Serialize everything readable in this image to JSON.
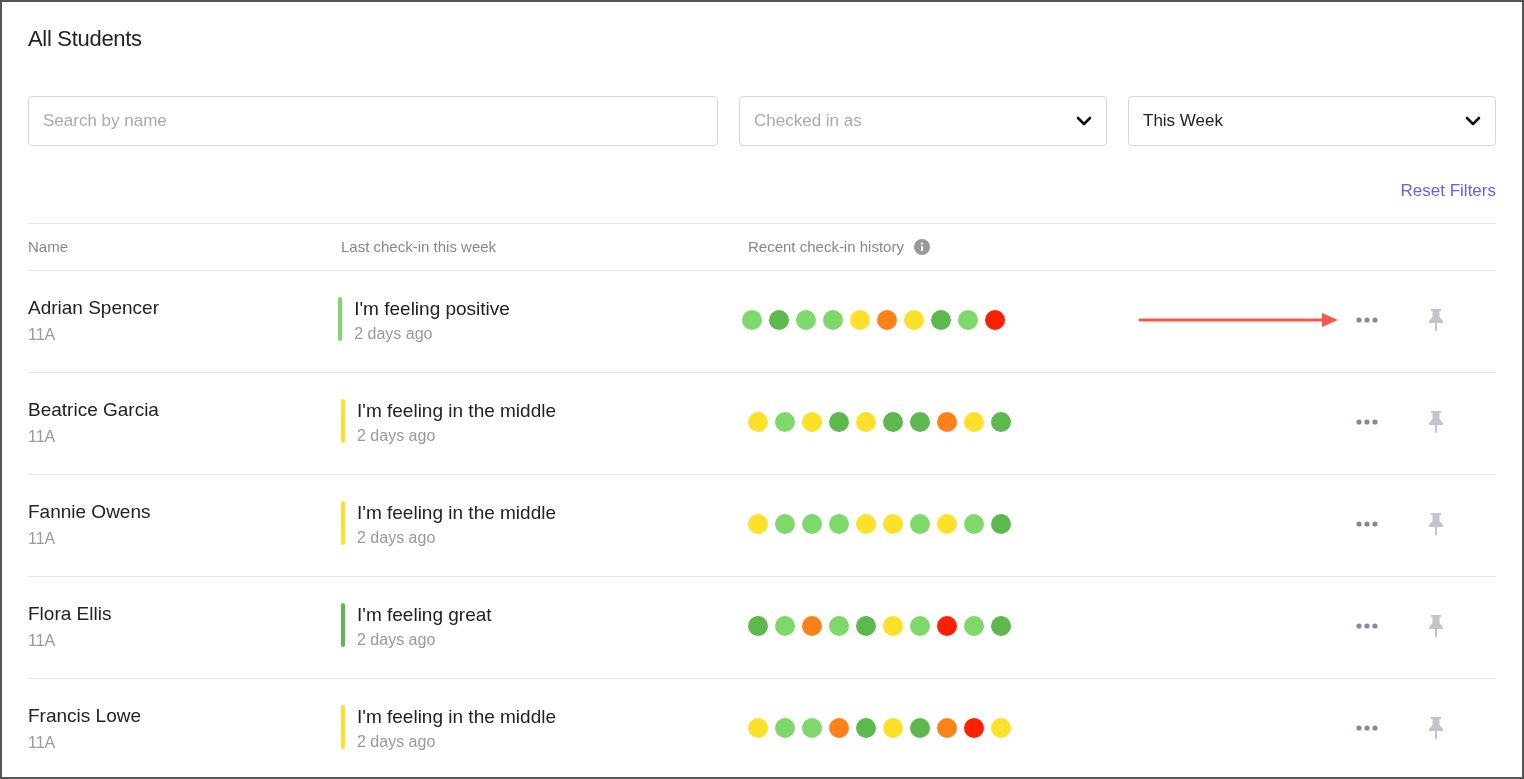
{
  "title": "All Students",
  "filters": {
    "search": {
      "placeholder": "Search by name"
    },
    "checked_in_as": {
      "placeholder": "Checked in as"
    },
    "period": {
      "value": "This Week"
    },
    "reset": "Reset Filters"
  },
  "table": {
    "columns": [
      "Name",
      "Last check-in this week",
      "Recent check-in history"
    ],
    "rows": [
      {
        "name": "Adrian Spencer",
        "class": "11A",
        "mood": "I'm feeling positive",
        "color": "#7ed96a",
        "time": "2 days ago",
        "annotated": true,
        "history": [
          {
            "color": "#7ed96a"
          },
          {
            "color": "#5db84e"
          },
          {
            "color": "#7ed96a"
          },
          {
            "color": "#7ed96a"
          },
          {
            "color": "#fce02a"
          },
          {
            "color": "#fc8118"
          },
          {
            "color": "#fce02a"
          },
          {
            "color": "#5db84e"
          },
          {
            "color": "#7ed96a"
          },
          {
            "color": "#fc1f00"
          }
        ]
      },
      {
        "name": "Beatrice Garcia",
        "class": "11A",
        "mood": "I'm feeling in the middle",
        "color": "#fce02a",
        "time": "2 days ago",
        "annotated": false,
        "history": [
          {
            "color": "#fce02a"
          },
          {
            "color": "#7ed96a"
          },
          {
            "color": "#fce02a"
          },
          {
            "color": "#5db84e"
          },
          {
            "color": "#fce02a"
          },
          {
            "color": "#5db84e"
          },
          {
            "color": "#5db84e"
          },
          {
            "color": "#fc8118"
          },
          {
            "color": "#fce02a"
          },
          {
            "color": "#5db84e"
          }
        ]
      },
      {
        "name": "Fannie Owens",
        "class": "11A",
        "mood": "I'm feeling in the middle",
        "color": "#fce02a",
        "time": "2 days ago",
        "annotated": false,
        "history": [
          {
            "color": "#fce02a"
          },
          {
            "color": "#7ed96a"
          },
          {
            "color": "#7ed96a"
          },
          {
            "color": "#7ed96a"
          },
          {
            "color": "#fce02a"
          },
          {
            "color": "#fce02a"
          },
          {
            "color": "#7ed96a"
          },
          {
            "color": "#fce02a"
          },
          {
            "color": "#7ed96a"
          },
          {
            "color": "#5db84e"
          }
        ]
      },
      {
        "name": "Flora Ellis",
        "class": "11A",
        "mood": "I'm feeling great",
        "color": "#5db84e",
        "time": "2 days ago",
        "annotated": false,
        "history": [
          {
            "color": "#5db84e"
          },
          {
            "color": "#7ed96a"
          },
          {
            "color": "#fc8118"
          },
          {
            "color": "#7ed96a"
          },
          {
            "color": "#5db84e"
          },
          {
            "color": "#fce02a"
          },
          {
            "color": "#7ed96a"
          },
          {
            "color": "#fc1f00"
          },
          {
            "color": "#7ed96a"
          },
          {
            "color": "#5db84e"
          }
        ]
      },
      {
        "name": "Francis Lowe",
        "class": "11A",
        "mood": "I'm feeling in the middle",
        "color": "#fce02a",
        "time": "2 days ago",
        "annotated": false,
        "history": [
          {
            "color": "#fce02a"
          },
          {
            "color": "#7ed96a"
          },
          {
            "color": "#7ed96a"
          },
          {
            "color": "#fc8118"
          },
          {
            "color": "#5db84e"
          },
          {
            "color": "#fce02a"
          },
          {
            "color": "#5db84e"
          },
          {
            "color": "#fc8118"
          },
          {
            "color": "#fc1f00"
          },
          {
            "color": "#fce02a"
          }
        ]
      }
    ]
  }
}
